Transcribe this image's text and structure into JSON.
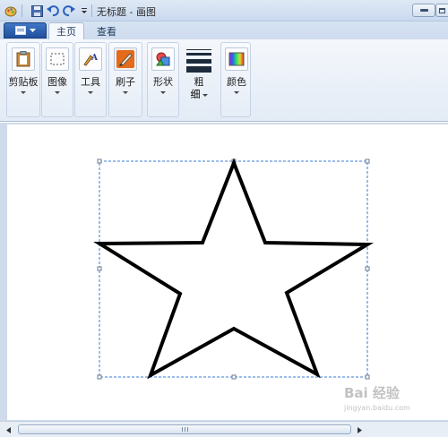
{
  "window": {
    "title": "无标题 - 画图"
  },
  "tabs": [
    {
      "label": "主页",
      "active": true
    },
    {
      "label": "查看",
      "active": false
    }
  ],
  "ribbon": {
    "clipboard": {
      "label": "剪贴板"
    },
    "image": {
      "label": "图像"
    },
    "tools": {
      "label": "工具"
    },
    "brushes": {
      "label": "刷子"
    },
    "shapes": {
      "label": "形状"
    },
    "size": {
      "label_line1": "粗",
      "label_line2": "细"
    },
    "colors": {
      "label": "颜色"
    }
  },
  "canvas": {
    "shape": "star",
    "stroke_color": "#000000",
    "selection_color": "#3a7bd5"
  },
  "watermark": {
    "text": "Bai 经验",
    "sub": "jingyan.baidu.com"
  },
  "colors": {
    "accent": "#1f4f9c",
    "ribbon_bg": "#e3ebf6",
    "workspace_bg": "#cfdbea"
  }
}
